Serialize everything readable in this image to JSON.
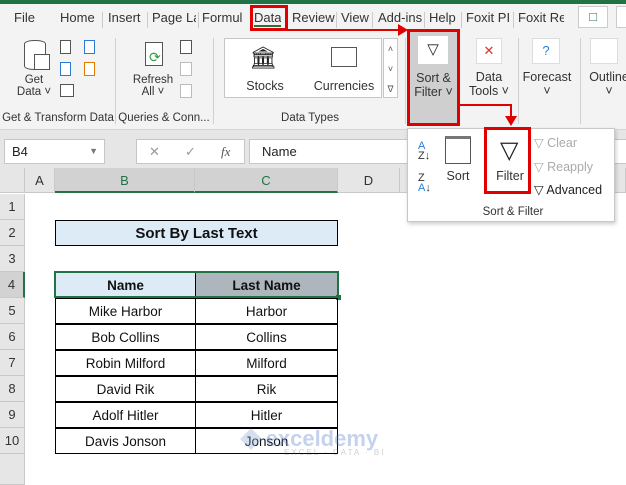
{
  "tabs": [
    "File",
    "Home",
    "Insert",
    "Page La",
    "Formul",
    "Data",
    "Review",
    "View",
    "Add-ins",
    "Help",
    "Foxit PI",
    "Foxit Re"
  ],
  "ribbon": {
    "get_data": "Get",
    "get_data2": "Data ˅",
    "group_get": "Get & Transform Data",
    "refresh": "Refresh",
    "refresh2": "All ˅",
    "group_queries": "Queries & Conn...",
    "stocks": "Stocks",
    "currencies": "Currencies",
    "group_types": "Data Types",
    "sort_filter": "Sort &",
    "sort_filter2": "Filter ˅",
    "data_tools": "Data",
    "data_tools2": "Tools ˅",
    "forecast": "Forecast",
    "forecast2": "˅",
    "outline": "Outline",
    "outline2": "˅"
  },
  "dropdown": {
    "sort": "Sort",
    "filter": "Filter",
    "clear": "Clear",
    "reapply": "Reapply",
    "advanced": "Advanced",
    "group": "Sort & Filter"
  },
  "formula_bar": {
    "name_box": "B4",
    "fx": "fx",
    "content": "Name"
  },
  "columns": [
    "A",
    "B",
    "C",
    "D"
  ],
  "rows": [
    "1",
    "2",
    "3",
    "4",
    "5",
    "6",
    "7",
    "8",
    "9",
    "10"
  ],
  "sheet": {
    "title": "Sort By Last Text",
    "headers": [
      "Name",
      "Last Name"
    ],
    "data": [
      [
        "Mike Harbor",
        "Harbor"
      ],
      [
        "Bob Collins",
        "Collins"
      ],
      [
        "Robin Milford",
        "Milford"
      ],
      [
        "David Rik",
        "Rik"
      ],
      [
        "Adolf Hitler",
        "Hitler"
      ],
      [
        "Davis Jonson",
        "Jonson"
      ]
    ]
  },
  "watermark": {
    "name": "exceldemy",
    "tagline": "EXCEL · DATA · BI"
  },
  "colors": {
    "accent": "#217346",
    "highlight": "#e00000",
    "header_fill": "#ddebf7",
    "last_header_fill": "#adb5bd"
  }
}
